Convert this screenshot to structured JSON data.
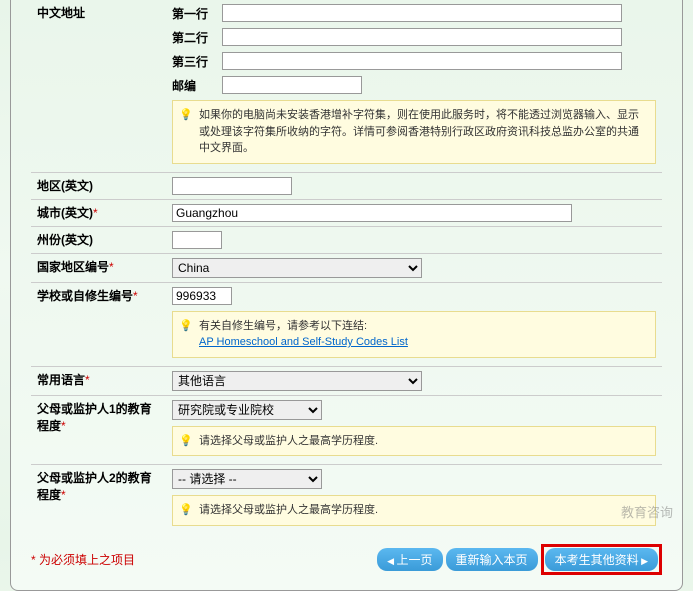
{
  "labels": {
    "chinese_address": "中文地址",
    "line1": "第一行",
    "line2": "第二行",
    "line3": "第三行",
    "postal": "邮编",
    "region_en": "地区(英文)",
    "city_en": "城市(英文)",
    "state_en": "州份(英文)",
    "country_code": "国家地区编号",
    "school_code": "学校或自修生编号",
    "language": "常用语言",
    "parent1_edu": "父母或监护人1的教育程度",
    "parent2_edu": "父母或监护人2的教育程度"
  },
  "values": {
    "line1": "",
    "line2": "",
    "line3": "",
    "postal": "",
    "region_en": "",
    "city_en": "Guangzhou",
    "state_en": "",
    "country": "China",
    "school_code": "996933",
    "language": "其他语言",
    "parent1_edu": "研究院或专业院校",
    "parent2_edu": "-- 请选择 --"
  },
  "info": {
    "hk_chars": "如果你的电脑尚未安装香港增补字符集，则在使用此服务时，将不能透过浏览器输入、显示或处理该字符集所收纳的字符。详情可参阅香港特别行政区政府资讯科技总监办公室的共通中文界面。",
    "homeschool_prefix": "有关自修生编号，请参考以下连结:",
    "homeschool_link": "AP Homeschool and Self-Study Codes List",
    "parent1_warn": "请选择父母或监护人之最高学历程度.",
    "parent2_warn": "请选择父母或监护人之最高学历程度."
  },
  "footer": {
    "required_note": "为必须填上之项目",
    "btn_prev": "上一页",
    "btn_reset": "重新输入本页",
    "btn_next": "本考生其他资料"
  },
  "required_mark": "*",
  "watermark": "教育咨询"
}
